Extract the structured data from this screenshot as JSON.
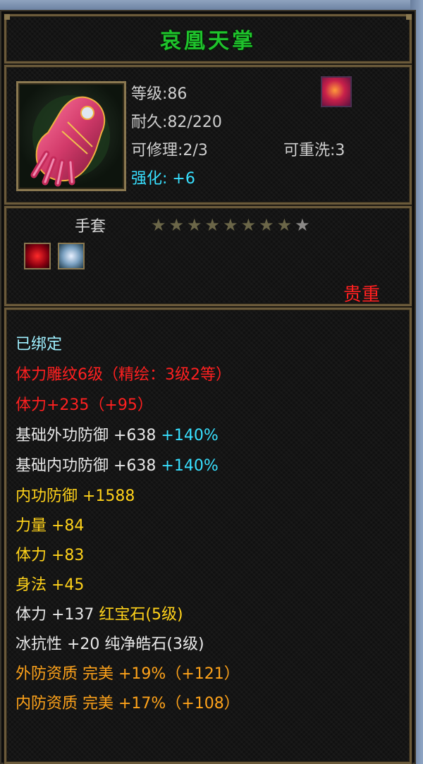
{
  "item": {
    "name": "哀凰天掌",
    "level": "等级:86",
    "durability": "耐久:82/220",
    "repair": "可修理:2/3",
    "rewash": "可重洗:3",
    "enhance": "强化: +6",
    "type": "手套",
    "rarity": "贵重",
    "stars_total": 9,
    "stars_filled": 8
  },
  "icons": {
    "main": "glove-icon",
    "badge": "gem-badge-icon",
    "slot1": "red-gem-slot-icon",
    "slot2": "white-gem-slot-icon"
  },
  "stats": [
    {
      "text": "已绑定",
      "color": "cyan"
    },
    {
      "text": "体力雕纹6级（精绘：3级2等）",
      "color": "red"
    },
    {
      "text": "体力+235（+95）",
      "color": "red"
    },
    {
      "text": "基础外功防御 +638",
      "extra": "+140%",
      "color": "white"
    },
    {
      "text": "基础内功防御 +638",
      "extra": "+140%",
      "color": "white"
    },
    {
      "text": "内功防御 +1588",
      "color": "yellow"
    },
    {
      "text": "力量 +84",
      "color": "yellow"
    },
    {
      "text": "体力 +83",
      "color": "yellow"
    },
    {
      "text": "身法 +45",
      "color": "yellow"
    },
    {
      "text": "体力 +137 ",
      "extra_text": "红宝石(5级)",
      "color": "white",
      "extra_color": "yellow"
    },
    {
      "text": "冰抗性 +20 纯净皓石(3级)",
      "color": "white"
    },
    {
      "text": "外防资质 完美 +19%（+121）",
      "color": "orange"
    },
    {
      "text": "内防资质 完美 +17%（+108）",
      "color": "orange"
    }
  ],
  "colors": {
    "title": "#1fc22c",
    "cyan": "#38e0ff",
    "red": "#ff2020",
    "yellow": "#ffd21a",
    "orange": "#ffa31a",
    "white": "#e8e8e8",
    "frame": "#8a7850"
  }
}
